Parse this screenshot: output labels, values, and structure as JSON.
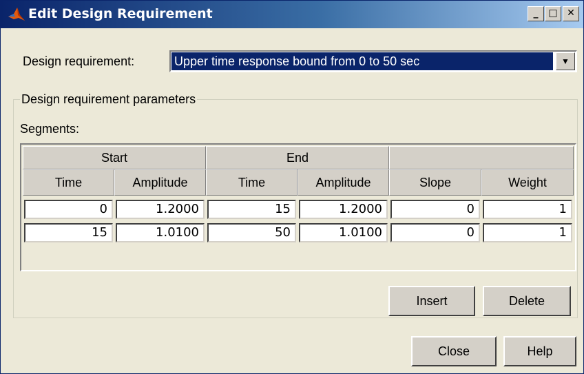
{
  "window": {
    "title": "Edit Design Requirement",
    "min_glyph": "_",
    "max_glyph": "□",
    "close_glyph": "✕"
  },
  "requirement": {
    "label": "Design requirement:",
    "selected": "Upper time response bound from 0 to 50 sec",
    "arrow_glyph": "▼"
  },
  "params": {
    "group_label": "Design requirement parameters",
    "segments_label": "Segments:"
  },
  "table": {
    "group_headers": [
      "Start",
      "End",
      ""
    ],
    "columns": [
      "Time",
      "Amplitude",
      "Time",
      "Amplitude",
      "Slope",
      "Weight"
    ],
    "rows": [
      [
        "0",
        "1.2000",
        "15",
        "1.2000",
        "0",
        "1"
      ],
      [
        "15",
        "1.0100",
        "50",
        "1.0100",
        "0",
        "1"
      ]
    ]
  },
  "buttons": {
    "insert": "Insert",
    "delete": "Delete",
    "close": "Close",
    "help": "Help"
  }
}
